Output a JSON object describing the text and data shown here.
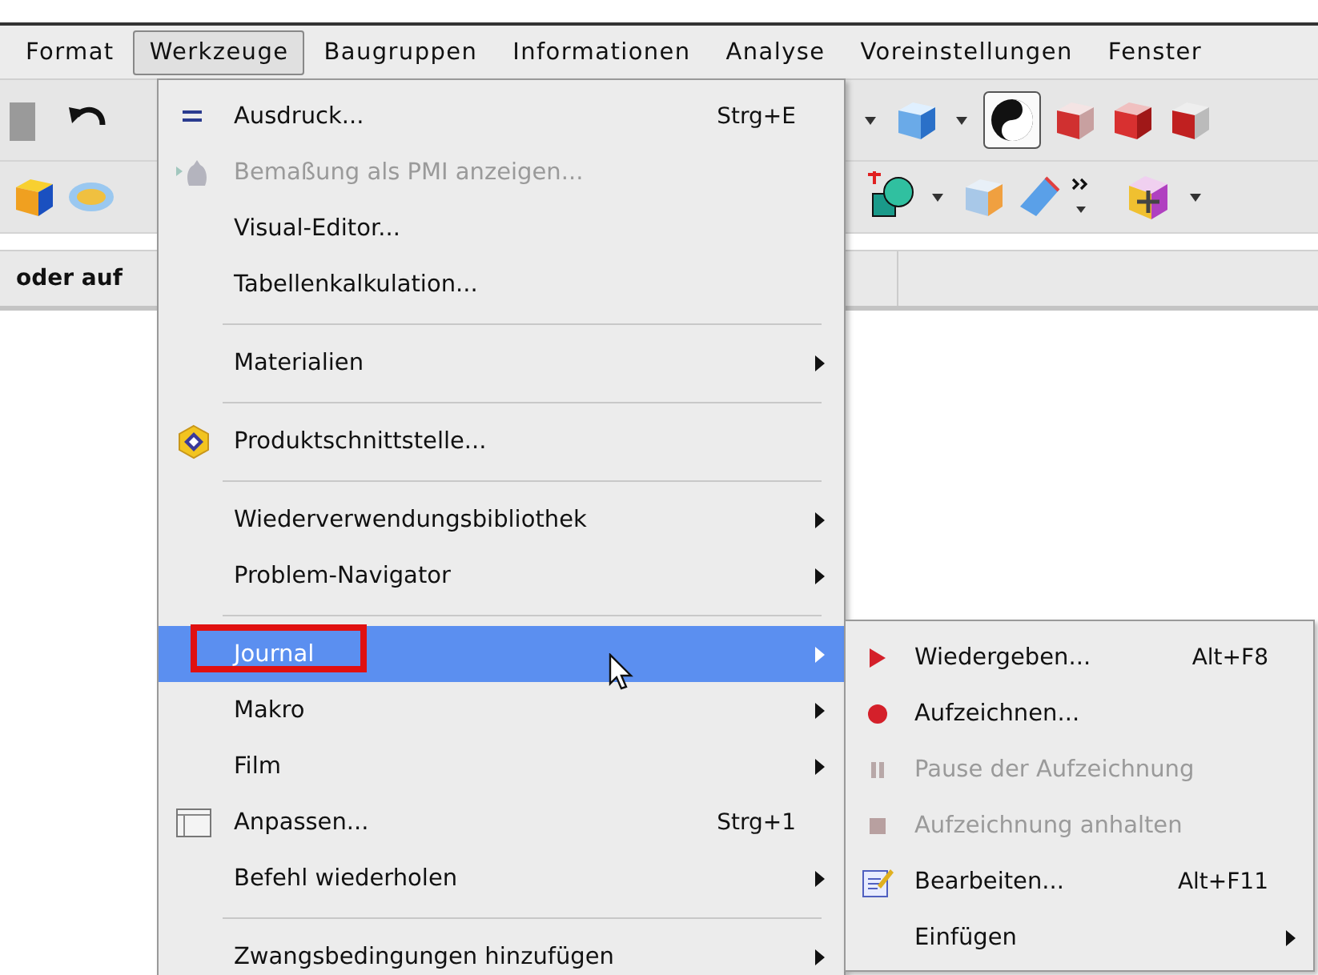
{
  "menubar": {
    "items": [
      {
        "label": "Format",
        "selected": false
      },
      {
        "label": "Werkzeuge",
        "selected": true
      },
      {
        "label": "Baugruppen",
        "selected": false
      },
      {
        "label": "Informationen",
        "selected": false
      },
      {
        "label": "Analyse",
        "selected": false
      },
      {
        "label": "Voreinstellungen",
        "selected": false
      },
      {
        "label": "Fenster",
        "selected": false
      }
    ]
  },
  "toolbar": {
    "hint": "oder auf"
  },
  "menu": {
    "items": [
      {
        "kind": "item",
        "label": "Ausdruck...",
        "shortcut": "Strg+E",
        "disabled": false,
        "submenu": false,
        "selected": false,
        "outlined": false
      },
      {
        "kind": "item",
        "label": "Bemaßung als PMI anzeigen...",
        "disabled": true,
        "submenu": false,
        "selected": false,
        "outlined": false
      },
      {
        "kind": "item",
        "label": "Visual-Editor...",
        "disabled": false,
        "submenu": false,
        "selected": false,
        "outlined": false
      },
      {
        "kind": "item",
        "label": "Tabellenkalkulation...",
        "disabled": false,
        "submenu": false,
        "selected": false,
        "outlined": false
      },
      {
        "kind": "separator"
      },
      {
        "kind": "item",
        "label": "Materialien",
        "disabled": false,
        "submenu": true,
        "selected": false,
        "outlined": false
      },
      {
        "kind": "separator"
      },
      {
        "kind": "item",
        "label": "Produktschnittstelle...",
        "disabled": false,
        "submenu": false,
        "selected": false,
        "outlined": false
      },
      {
        "kind": "separator"
      },
      {
        "kind": "item",
        "label": "Wiederverwendungsbibliothek",
        "disabled": false,
        "submenu": true,
        "selected": false,
        "outlined": false
      },
      {
        "kind": "item",
        "label": "Problem-Navigator",
        "disabled": false,
        "submenu": true,
        "selected": false,
        "outlined": false
      },
      {
        "kind": "separator"
      },
      {
        "kind": "item",
        "label": "Journal",
        "disabled": false,
        "submenu": true,
        "selected": true,
        "outlined": true
      },
      {
        "kind": "item",
        "label": "Makro",
        "disabled": false,
        "submenu": true,
        "selected": false,
        "outlined": false
      },
      {
        "kind": "item",
        "label": "Film",
        "disabled": false,
        "submenu": true,
        "selected": false,
        "outlined": false
      },
      {
        "kind": "item",
        "label": "Anpassen...",
        "shortcut": "Strg+1",
        "disabled": false,
        "submenu": false,
        "selected": false,
        "outlined": false
      },
      {
        "kind": "item",
        "label": "Befehl wiederholen",
        "disabled": false,
        "submenu": true,
        "selected": false,
        "outlined": false
      },
      {
        "kind": "separator"
      },
      {
        "kind": "item",
        "label": "Zwangsbedingungen hinzufügen",
        "disabled": false,
        "submenu": true,
        "selected": false,
        "outlined": false
      }
    ]
  },
  "submenu": {
    "items": [
      {
        "label": "Wiedergeben...",
        "shortcut": "Alt+F8",
        "disabled": false,
        "submenu": false
      },
      {
        "label": "Aufzeichnen...",
        "disabled": false,
        "submenu": false
      },
      {
        "label": "Pause der Aufzeichnung",
        "disabled": true,
        "submenu": false
      },
      {
        "label": "Aufzeichnung anhalten",
        "disabled": true,
        "submenu": false
      },
      {
        "label": "Bearbeiten...",
        "shortcut": "Alt+F11",
        "disabled": false,
        "submenu": false
      },
      {
        "label": "Einfügen",
        "disabled": false,
        "submenu": true
      }
    ]
  }
}
